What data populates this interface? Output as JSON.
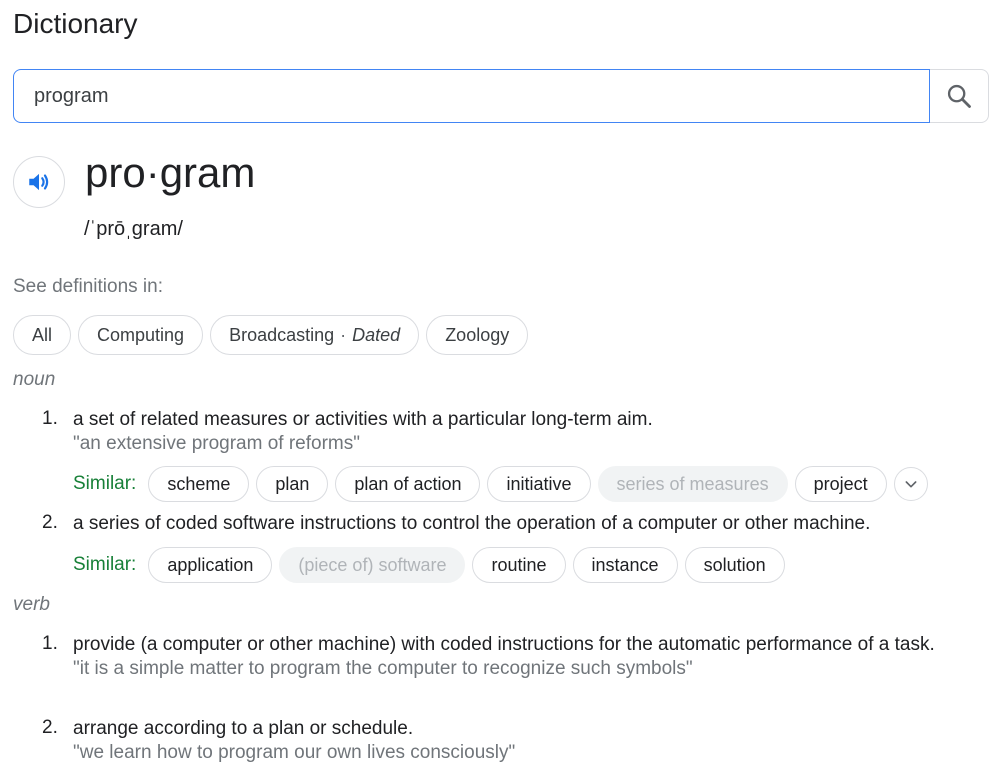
{
  "page": {
    "title": "Dictionary"
  },
  "search": {
    "value": "program",
    "button_icon": "search-icon"
  },
  "entry": {
    "headword": "pro·gram",
    "phonetic": "/ˈprōˌɡram/",
    "audio_icon": "speaker-icon"
  },
  "see_definitions": {
    "label": "See definitions in:",
    "chips": {
      "all": "All",
      "computing": "Computing",
      "broadcasting": "Broadcasting",
      "separator": "·",
      "broadcasting_note": "Dated",
      "zoology": "Zoology"
    }
  },
  "noun": {
    "pos": "noun",
    "defs": [
      {
        "num": "1.",
        "text": "a set of related measures or activities with a particular long-term aim.",
        "example": "\"an extensive program of reforms\"",
        "similar_label": "Similar:",
        "similar": [
          "scheme",
          "plan",
          "plan of action",
          "initiative",
          "series of measures",
          "project"
        ]
      },
      {
        "num": "2.",
        "text": "a series of coded software instructions to control the operation of a computer or other machine.",
        "similar_label": "Similar:",
        "similar": [
          "application",
          "(piece of) software",
          "routine",
          "instance",
          "solution"
        ]
      }
    ]
  },
  "verb": {
    "pos": "verb",
    "defs": [
      {
        "num": "1.",
        "text": "provide (a computer or other machine) with coded instructions for the automatic performance of a task.",
        "example": "\"it is a simple matter to program the computer to recognize such symbols\""
      },
      {
        "num": "2.",
        "text": "arrange according to a plan or schedule.",
        "example": "\"we learn how to program our own lives consciously\""
      }
    ]
  },
  "colors": {
    "accent": "#4285f4",
    "similar_label": "#188038",
    "muted_text": "#70757a",
    "chip_border": "#dadce0",
    "speaker_blue": "#1a73e8"
  }
}
